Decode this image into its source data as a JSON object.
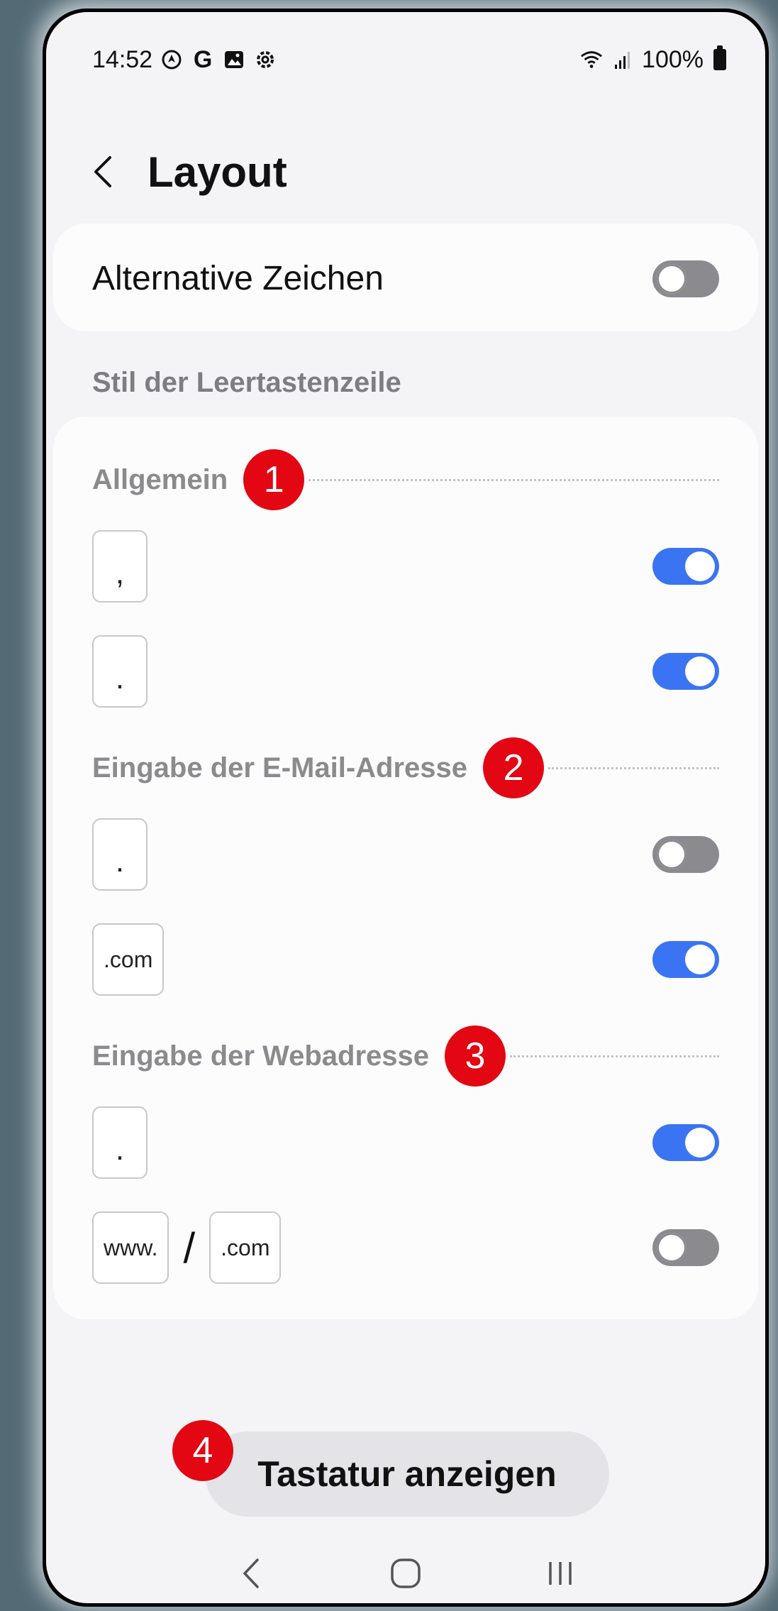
{
  "status_bar": {
    "time": "14:52",
    "left_icons": [
      "navigation-icon",
      "google-icon",
      "gallery-icon",
      "settings-icon"
    ],
    "right_icons": [
      "wifi-icon",
      "signal-icon",
      "battery-icon"
    ],
    "battery": "100%"
  },
  "header": {
    "title": "Layout"
  },
  "alt_chars": {
    "label": "Alternative Zeichen",
    "enabled": false
  },
  "section_title": "Stil der Leertastenzeile",
  "groups": [
    {
      "title": "Allgemein",
      "badge": "1",
      "rows": [
        {
          "keys": [
            ","
          ],
          "enabled": true
        },
        {
          "keys": [
            "."
          ],
          "enabled": true
        }
      ]
    },
    {
      "title": "Eingabe der E-Mail-Adresse",
      "badge": "2",
      "rows": [
        {
          "keys": [
            "."
          ],
          "enabled": false
        },
        {
          "keys": [
            ".com"
          ],
          "enabled": true
        }
      ]
    },
    {
      "title": "Eingabe der Webadresse",
      "badge": "3",
      "rows": [
        {
          "keys": [
            "."
          ],
          "enabled": true
        },
        {
          "keys": [
            "www.",
            "/",
            ".com"
          ],
          "enabled": false
        }
      ]
    }
  ],
  "bottom": {
    "badge": "4",
    "button_label": "Tastatur anzeigen"
  },
  "nav_bar": [
    "back-nav-icon",
    "home-nav-icon",
    "recents-nav-icon"
  ],
  "colors": {
    "accent": "#3a74f2",
    "badge": "#e30613",
    "toggle_off": "#8a8a8f"
  }
}
